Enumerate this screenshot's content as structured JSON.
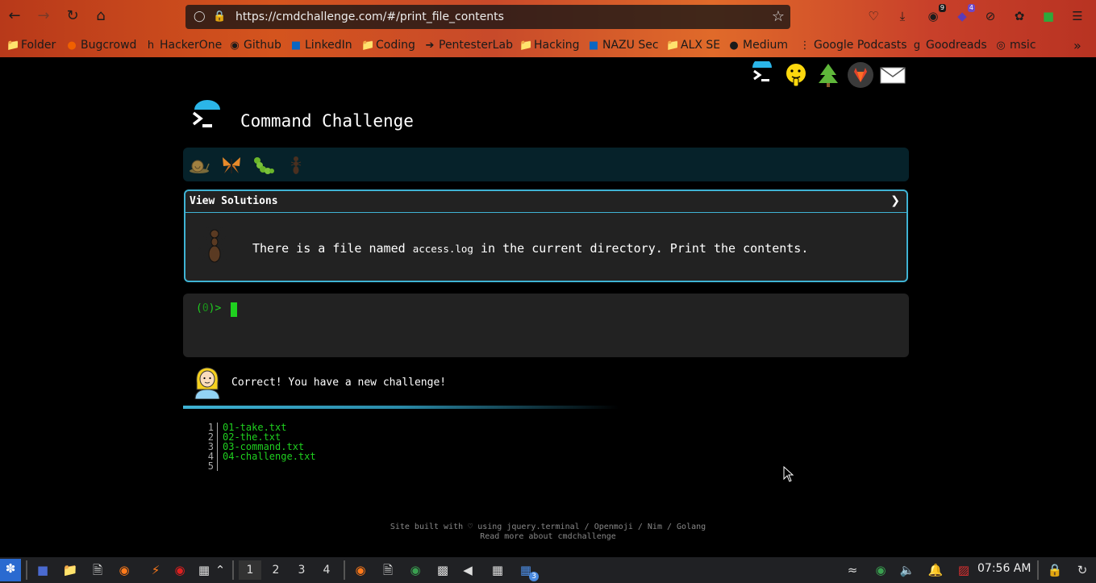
{
  "browser": {
    "url": "https://cmdchallenge.com/#/print_file_contents",
    "badges": {
      "notifications": "9",
      "extension": "4"
    },
    "bookmarks": [
      {
        "label": "Folder",
        "icon": "folder-icon"
      },
      {
        "label": "Bugcrowd",
        "icon": "bugcrowd-icon"
      },
      {
        "label": "HackerOne",
        "icon": "hackerone-icon"
      },
      {
        "label": "Github",
        "icon": "github-icon"
      },
      {
        "label": "LinkedIn",
        "icon": "linkedin-icon"
      },
      {
        "label": "Coding",
        "icon": "folder-icon"
      },
      {
        "label": "PentesterLab",
        "icon": "pentesterlab-icon"
      },
      {
        "label": "Hacking",
        "icon": "folder-icon"
      },
      {
        "label": "NAZU Sec",
        "icon": "linkedin-icon"
      },
      {
        "label": "ALX SE",
        "icon": "folder-icon"
      },
      {
        "label": "Medium",
        "icon": "medium-icon"
      },
      {
        "label": "Google Podcasts",
        "icon": "podcasts-icon"
      },
      {
        "label": "Goodreads",
        "icon": "goodreads-icon"
      },
      {
        "label": "msic",
        "icon": "globe-icon"
      }
    ]
  },
  "page": {
    "title": "Command Challenge",
    "challenge": {
      "header": "View Solutions",
      "desc_before": "There is a file named ",
      "desc_code": "access.log",
      "desc_after": " in the current directory. Print the contents."
    },
    "terminal": {
      "prompt_open": "(",
      "prompt_num": "0",
      "prompt_close": ")> "
    },
    "message": "Correct! You have a new challenge!",
    "files": [
      {
        "num": "1",
        "name": "01-take.txt"
      },
      {
        "num": "2",
        "name": "02-the.txt"
      },
      {
        "num": "3",
        "name": "03-command.txt"
      },
      {
        "num": "4",
        "name": "04-challenge.txt"
      },
      {
        "num": "5",
        "name": ""
      }
    ],
    "footer_line1": "Site built with ♡ using jquery.terminal / Openmoji / Nim / Golang",
    "footer_line2": "Read more about cmdchallenge"
  },
  "taskbar": {
    "workspaces": [
      "1",
      "2",
      "3",
      "4"
    ],
    "window_badge": "3",
    "clock": "07:56 AM"
  }
}
